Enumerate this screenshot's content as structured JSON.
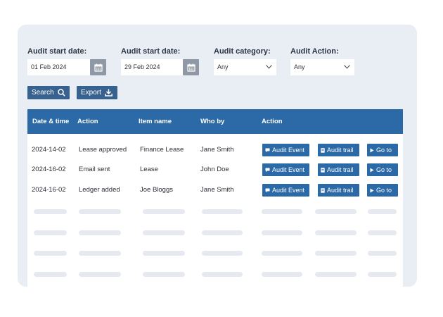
{
  "filters": {
    "start_date_1": {
      "label": "Audit start date:",
      "value": "01 Feb 2024"
    },
    "start_date_2": {
      "label": "Audit start date:",
      "value": "29 Feb 2024"
    },
    "category": {
      "label": "Audit category:",
      "value": "Any"
    },
    "action": {
      "label": "Audit Action:",
      "value": "Any"
    }
  },
  "buttons": {
    "search": "Search",
    "export": "Export"
  },
  "table": {
    "headers": [
      "Date & time",
      "Action",
      "Item name",
      "Who by",
      "Action"
    ],
    "rows": [
      {
        "date": "2024-14-02",
        "action": "Lease approved",
        "item": "Finance Lease",
        "who": "Jane Smith"
      },
      {
        "date": "2024-16-02",
        "action": "Email sent",
        "item": "Lease",
        "who": "John Doe"
      },
      {
        "date": "2024-16-02",
        "action": "Ledger added",
        "item": "Joe Bloggs",
        "who": "Jane Smith"
      }
    ],
    "row_buttons": {
      "audit_event": "Audit Event",
      "audit_trail": "Audit trail",
      "go_to": "Go to"
    }
  },
  "colors": {
    "accent": "#2c6aa7",
    "dark_button": "#37618e",
    "panel": "#e9edf4",
    "skeleton": "#e6e9ef"
  },
  "icons": [
    "calendar-icon",
    "chevron-down-icon",
    "search-icon",
    "download-icon",
    "comment-icon",
    "document-icon",
    "play-icon"
  ]
}
